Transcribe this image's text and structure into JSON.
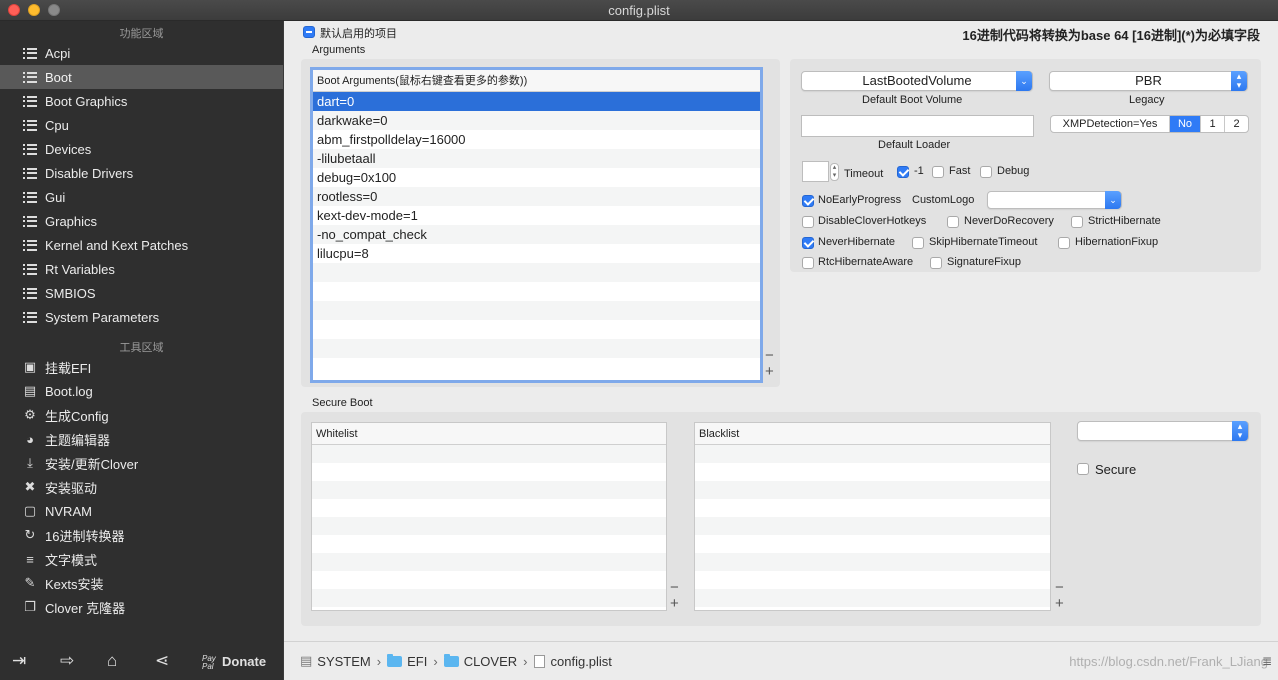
{
  "window": {
    "title": "config.plist"
  },
  "sidebar": {
    "section1_title": "功能区域",
    "items": [
      {
        "label": "Acpi"
      },
      {
        "label": "Boot"
      },
      {
        "label": "Boot Graphics"
      },
      {
        "label": "Cpu"
      },
      {
        "label": "Devices"
      },
      {
        "label": "Disable Drivers"
      },
      {
        "label": "Gui"
      },
      {
        "label": "Graphics"
      },
      {
        "label": "Kernel and Kext Patches"
      },
      {
        "label": "Rt Variables"
      },
      {
        "label": "SMBIOS"
      },
      {
        "label": "System Parameters"
      }
    ],
    "section2_title": "工具区域",
    "tools": [
      {
        "label": "挂载EFI"
      },
      {
        "label": "Boot.log"
      },
      {
        "label": "生成Config"
      },
      {
        "label": "主题编辑器"
      },
      {
        "label": "安装/更新Clover"
      },
      {
        "label": "安装驱动"
      },
      {
        "label": "NVRAM"
      },
      {
        "label": "16进制转换器"
      },
      {
        "label": "文字模式"
      },
      {
        "label": "Kexts安装"
      },
      {
        "label": "Clover 克隆器"
      }
    ],
    "bottom": {
      "paypal": "Pay Pal",
      "donate": "Donate"
    }
  },
  "main": {
    "default_enabled_label": "默认启用的项目",
    "hex_notice": "16进制代码将转换为base 64 [16进制](*)为必填字段",
    "arguments_label": "Arguments",
    "boot_args_header": "Boot Arguments(鼠标右键查看更多的参数))",
    "boot_args": [
      "dart=0",
      "darkwake=0",
      "abm_firstpolldelay=16000",
      "-lilubetaall",
      "debug=0x100",
      "rootless=0",
      "kext-dev-mode=1",
      "-no_compat_check",
      "lilucpu=8"
    ],
    "default_boot_volume_value": "LastBootedVolume",
    "default_boot_volume_label": "Default Boot Volume",
    "legacy_value": "PBR",
    "legacy_label": "Legacy",
    "default_loader_label": "Default Loader",
    "xmp": {
      "label": "XMPDetection=Yes",
      "no": "No",
      "one": "1",
      "two": "2"
    },
    "timeout_label": "Timeout",
    "minus_one_label": "-1",
    "fast_label": "Fast",
    "debug_label": "Debug",
    "no_early_progress_label": "NoEarlyProgress",
    "custom_logo_label": "CustomLogo",
    "disable_clover_hotkeys_label": "DisableCloverHotkeys",
    "never_do_recovery_label": "NeverDoRecovery",
    "strict_hibernate_label": "StrictHibernate",
    "never_hibernate_label": "NeverHibernate",
    "skip_hibernate_timeout_label": "SkipHibernateTimeout",
    "hibernation_fixup_label": "HibernationFixup",
    "rtc_hibernate_aware_label": "RtcHibernateAware",
    "signature_fixup_label": "SignatureFixup",
    "secure_boot_label": "Secure Boot",
    "whitelist_header": "Whitelist",
    "blacklist_header": "Blacklist",
    "secure_label": "Secure"
  },
  "pathbar": {
    "items": [
      "SYSTEM",
      "EFI",
      "CLOVER",
      "config.plist"
    ]
  },
  "watermark": "https://blog.csdn.net/Frank_LJiang"
}
